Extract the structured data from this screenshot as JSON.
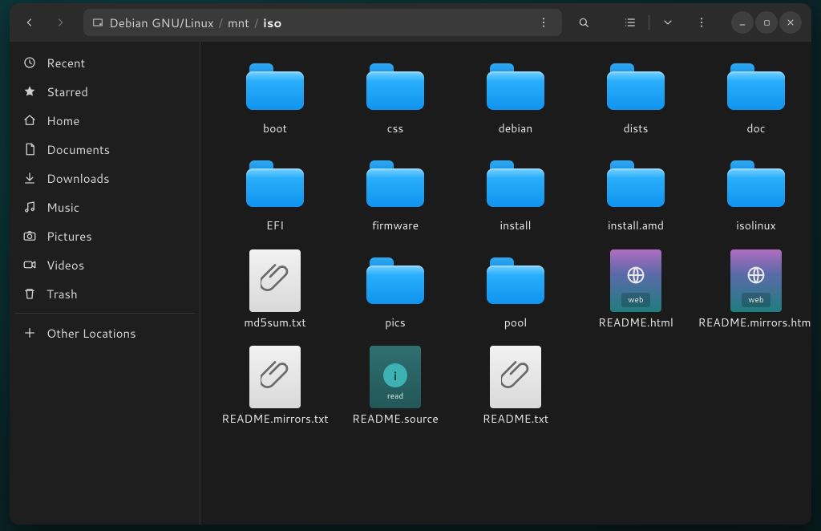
{
  "titlebar": {
    "path_root": "Debian GNU/Linux",
    "path_segments": [
      "mnt",
      "iso"
    ]
  },
  "file_web_tag": "web",
  "file_read_tag": "read",
  "sidebar": {
    "items": [
      {
        "label": "Recent",
        "icon": "clock"
      },
      {
        "label": "Starred",
        "icon": "star"
      },
      {
        "label": "Home",
        "icon": "home"
      },
      {
        "label": "Documents",
        "icon": "document"
      },
      {
        "label": "Downloads",
        "icon": "download"
      },
      {
        "label": "Music",
        "icon": "music"
      },
      {
        "label": "Pictures",
        "icon": "camera"
      },
      {
        "label": "Videos",
        "icon": "video"
      },
      {
        "label": "Trash",
        "icon": "trash"
      }
    ],
    "other_locations": "Other Locations"
  },
  "files": [
    {
      "name": "boot",
      "type": "folder"
    },
    {
      "name": "css",
      "type": "folder"
    },
    {
      "name": "debian",
      "type": "folder"
    },
    {
      "name": "dists",
      "type": "folder"
    },
    {
      "name": "doc",
      "type": "folder"
    },
    {
      "name": "EFI",
      "type": "folder"
    },
    {
      "name": "firmware",
      "type": "folder"
    },
    {
      "name": "install",
      "type": "folder"
    },
    {
      "name": "install.amd",
      "type": "folder"
    },
    {
      "name": "isolinux",
      "type": "folder"
    },
    {
      "name": "md5sum.txt",
      "type": "attach"
    },
    {
      "name": "pics",
      "type": "folder"
    },
    {
      "name": "pool",
      "type": "folder"
    },
    {
      "name": "README.html",
      "type": "web"
    },
    {
      "name": "README.mirrors.html",
      "type": "web"
    },
    {
      "name": "README.mirrors.txt",
      "type": "attach"
    },
    {
      "name": "README.source",
      "type": "read"
    },
    {
      "name": "README.txt",
      "type": "attach"
    }
  ]
}
